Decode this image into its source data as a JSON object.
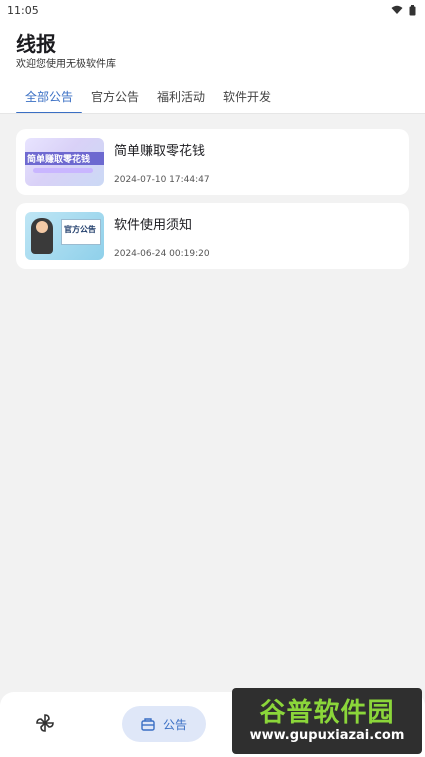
{
  "status_bar": {
    "time": "11:05"
  },
  "header": {
    "title": "线报",
    "subtitle": "欢迎您使用无极软件库"
  },
  "tabs": [
    {
      "label": "全部公告",
      "active": true
    },
    {
      "label": "官方公告",
      "active": false
    },
    {
      "label": "福利活动",
      "active": false
    },
    {
      "label": "软件开发",
      "active": false
    }
  ],
  "posts": [
    {
      "title": "简单赚取零花钱",
      "date": "2024-07-10 17:44:47",
      "thumb_text": "简单赚取零花钱"
    },
    {
      "title": "软件使用须知",
      "date": "2024-06-24 00:19:20",
      "thumb_text": "官方公告"
    }
  ],
  "bottom_nav": {
    "home_icon": "pinwheel-icon",
    "notice_label": "公告",
    "notice_icon": "notice-box-icon"
  },
  "watermark": {
    "line1": "谷普软件园",
    "line2": "www.gupuxiazai.com"
  },
  "colors": {
    "accent": "#3a6fc4",
    "pill_bg": "#dfe7f8",
    "background": "#f2f2f2"
  }
}
